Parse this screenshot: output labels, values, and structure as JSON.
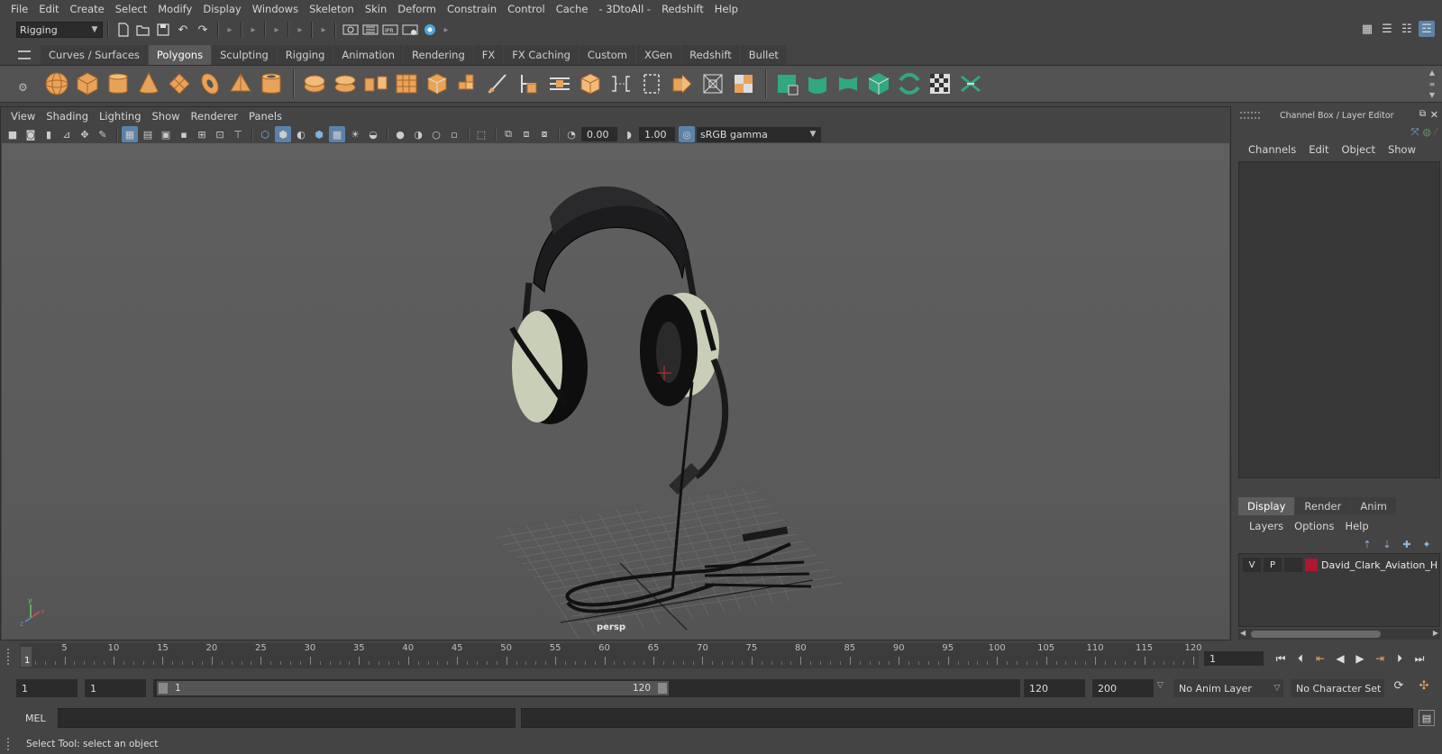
{
  "menubar": {
    "items": [
      "File",
      "Edit",
      "Create",
      "Select",
      "Modify",
      "Display",
      "Windows",
      "Skeleton",
      "Skin",
      "Deform",
      "Constrain",
      "Control",
      "Cache",
      "- 3DtoAll -",
      "Redshift",
      "Help"
    ]
  },
  "statusline": {
    "menuset": "Rigging"
  },
  "shelf": {
    "tabs": [
      "Curves / Surfaces",
      "Polygons",
      "Sculpting",
      "Rigging",
      "Animation",
      "Rendering",
      "FX",
      "FX Caching",
      "Custom",
      "XGen",
      "Redshift",
      "Bullet"
    ],
    "active_tab": "Polygons",
    "icons": [
      "poly-sphere-icon",
      "poly-cube-icon",
      "poly-cylinder-icon",
      "poly-cone-icon",
      "poly-plane-icon",
      "poly-torus-icon",
      "poly-pyramid-icon",
      "poly-pipe-icon",
      "combine-icon",
      "separate-icon",
      "extract-icon",
      "smooth-icon",
      "mirror-icon",
      "bevel-icon",
      "extrude-icon",
      "bridge-icon",
      "multi-cut-icon",
      "insert-edge-loop-icon",
      "merge-icon",
      "append-icon",
      "quad-draw-icon",
      "wedge-icon",
      "soft-mod-icon",
      "target-weld-icon",
      "planar-uv-icon",
      "cylindrical-uv-icon",
      "spherical-uv-icon",
      "automatic-uv-icon",
      "unfold-uv-icon",
      "uv-editor-icon",
      "layout-uv-icon"
    ]
  },
  "viewport": {
    "menu": [
      "View",
      "Shading",
      "Lighting",
      "Show",
      "Renderer",
      "Panels"
    ],
    "exposure": "0.00",
    "gamma": "1.00",
    "color_space": "sRGB gamma",
    "camera": "persp"
  },
  "channel_box": {
    "title": "Channel Box / Layer Editor",
    "menu": [
      "Channels",
      "Edit",
      "Object",
      "Show"
    ]
  },
  "layer_editor": {
    "tabs": [
      "Display",
      "Render",
      "Anim"
    ],
    "active_tab": "Display",
    "menu": [
      "Layers",
      "Options",
      "Help"
    ],
    "layer": {
      "visible": "V",
      "playback": "P",
      "name": "David_Clark_Aviation_He",
      "color": "#b0162c"
    }
  },
  "timeslider": {
    "ticks": [
      "5",
      "10",
      "15",
      "20",
      "25",
      "30",
      "35",
      "40",
      "45",
      "50",
      "55",
      "60",
      "65",
      "70",
      "75",
      "80",
      "85",
      "90",
      "95",
      "100",
      "105",
      "110",
      "115",
      "120"
    ],
    "current_marker": "1",
    "current_frame": "1"
  },
  "rangeslider": {
    "start": "1",
    "playback_start": "1",
    "range_start_label": "1",
    "range_end_label": "120",
    "playback_end": "120",
    "end": "200",
    "anim_layer": "No Anim Layer",
    "character_set": "No Character Set"
  },
  "cmdline": {
    "label": "MEL"
  },
  "helpline": {
    "text": "Select Tool: select an object"
  }
}
